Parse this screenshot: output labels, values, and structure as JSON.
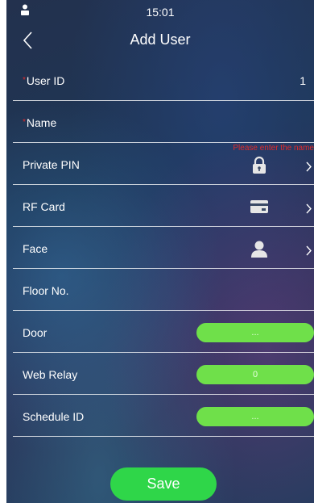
{
  "status": {
    "time": "15:01"
  },
  "header": {
    "title": "Add User"
  },
  "fields": {
    "user_id": {
      "required_mark": "*",
      "label": "User ID",
      "value": "1"
    },
    "name": {
      "required_mark": "*",
      "label": "Name",
      "error_hint": "Please enter the name"
    },
    "private_pin": {
      "label": "Private PIN",
      "icon": "lock-icon"
    },
    "rf_card": {
      "label": "RF Card",
      "icon": "card-icon"
    },
    "face": {
      "label": "Face",
      "icon": "person-icon"
    },
    "floor_no": {
      "label": "Floor No."
    },
    "door": {
      "label": "Door",
      "value": "..."
    },
    "web_relay": {
      "label": "Web Relay",
      "value": "0"
    },
    "schedule_id": {
      "label": "Schedule ID",
      "value": "..."
    }
  },
  "actions": {
    "save_label": "Save"
  },
  "colors": {
    "accent_green": "#6fe04a",
    "save_green": "#2fd649",
    "error_red": "#e02a2a"
  }
}
